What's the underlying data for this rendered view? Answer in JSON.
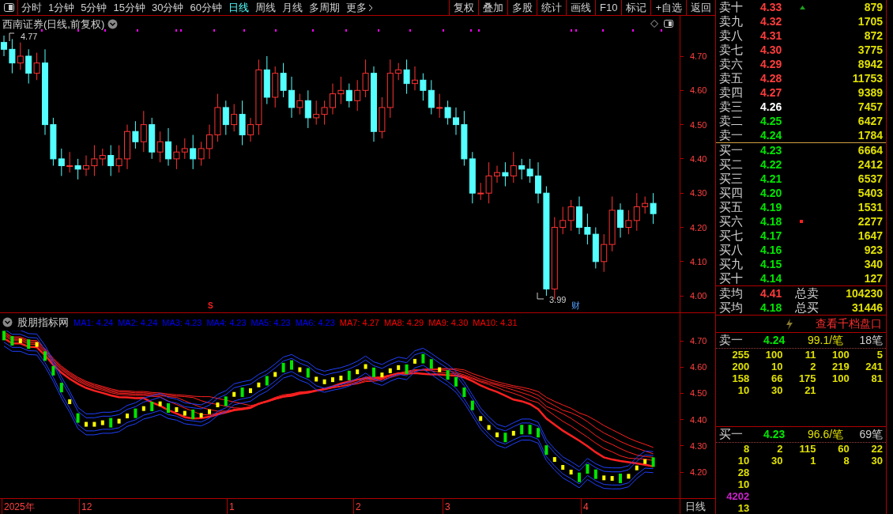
{
  "toolbar": {
    "periods": [
      {
        "label": "分时",
        "selected": false
      },
      {
        "label": "1分钟",
        "selected": false
      },
      {
        "label": "5分钟",
        "selected": false
      },
      {
        "label": "15分钟",
        "selected": false
      },
      {
        "label": "30分钟",
        "selected": false
      },
      {
        "label": "60分钟",
        "selected": false
      },
      {
        "label": "日线",
        "selected": true
      },
      {
        "label": "周线",
        "selected": false
      },
      {
        "label": "月线",
        "selected": false
      },
      {
        "label": "多周期",
        "selected": false
      },
      {
        "label": "更多",
        "selected": false
      }
    ],
    "buttons": [
      "复权",
      "叠加",
      "多股",
      "统计",
      "画线",
      "F10",
      "标记",
      "+自选",
      "返回"
    ]
  },
  "price_chart": {
    "title": "西南证券(日线,前复权)",
    "high_label": "4.77",
    "low_label": "3.99",
    "event_badge": "财",
    "sell_mark": "S",
    "yticks": [
      "4.70",
      "4.60",
      "4.50",
      "4.40",
      "4.30",
      "4.20",
      "4.10",
      "4.00"
    ]
  },
  "indicator": {
    "name": "股朋指标网",
    "ma": [
      {
        "label": "MA1: 4.24",
        "color": "#0000ff"
      },
      {
        "label": "MA2: 4.24",
        "color": "#0000ff"
      },
      {
        "label": "MA3: 4.23",
        "color": "#0000ff"
      },
      {
        "label": "MA4: 4.23",
        "color": "#0000ff"
      },
      {
        "label": "MA5: 4.23",
        "color": "#0000ff"
      },
      {
        "label": "MA6: 4.23",
        "color": "#0000ff"
      },
      {
        "label": "MA7: 4.27",
        "color": "#ff0000"
      },
      {
        "label": "MA8: 4.29",
        "color": "#ff0000"
      },
      {
        "label": "MA9: 4.30",
        "color": "#ff0000"
      },
      {
        "label": "MA10: 4.31",
        "color": "#ff0000"
      }
    ],
    "yticks": [
      "4.70",
      "4.60",
      "4.50",
      "4.40",
      "4.30",
      "4.20"
    ]
  },
  "time_axis": {
    "labels": [
      "2025年",
      "12",
      "1",
      "2",
      "3",
      "4"
    ],
    "period": "日线"
  },
  "order_book": {
    "asks": [
      {
        "label": "卖十",
        "price": "4.33",
        "volume": "879",
        "color": "#ff3c3c",
        "kind": "uptick"
      },
      {
        "label": "卖九",
        "price": "4.32",
        "volume": "1705",
        "color": "#ff3c3c",
        "kind": "plain"
      },
      {
        "label": "卖八",
        "price": "4.31",
        "volume": "872",
        "color": "#ff3c3c",
        "kind": "plain"
      },
      {
        "label": "卖七",
        "price": "4.30",
        "volume": "3775",
        "color": "#ff3c3c",
        "kind": "plain"
      },
      {
        "label": "卖六",
        "price": "4.29",
        "volume": "8942",
        "color": "#ff3c3c",
        "kind": "plain"
      },
      {
        "label": "卖五",
        "price": "4.28",
        "volume": "11753",
        "color": "#ff3c3c",
        "kind": "plain"
      },
      {
        "label": "卖四",
        "price": "4.27",
        "volume": "9389",
        "color": "#ff3c3c",
        "kind": "plain"
      },
      {
        "label": "卖三",
        "price": "4.26",
        "volume": "7457",
        "color": "#ffffff",
        "kind": "plain"
      },
      {
        "label": "卖二",
        "price": "4.25",
        "volume": "6427",
        "color": "#00e600",
        "kind": "plain"
      },
      {
        "label": "卖一",
        "price": "4.24",
        "volume": "1784",
        "color": "#00e600",
        "kind": "plain"
      }
    ],
    "bids": [
      {
        "label": "买一",
        "price": "4.23",
        "volume": "6664",
        "color": "#00e600",
        "kind": "plain"
      },
      {
        "label": "买二",
        "price": "4.22",
        "volume": "2412",
        "color": "#00e600",
        "kind": "plain"
      },
      {
        "label": "买三",
        "price": "4.21",
        "volume": "6537",
        "color": "#00e600",
        "kind": "plain"
      },
      {
        "label": "买四",
        "price": "4.20",
        "volume": "5403",
        "color": "#00e600",
        "kind": "plain"
      },
      {
        "label": "买五",
        "price": "4.19",
        "volume": "1531",
        "color": "#00e600",
        "kind": "plain"
      },
      {
        "label": "买六",
        "price": "4.18",
        "volume": "2277",
        "color": "#00e600",
        "kind": "flagged"
      },
      {
        "label": "买七",
        "price": "4.17",
        "volume": "1647",
        "color": "#00e600",
        "kind": "plain"
      },
      {
        "label": "买八",
        "price": "4.16",
        "volume": "923",
        "color": "#00e600",
        "kind": "plain"
      },
      {
        "label": "买九",
        "price": "4.15",
        "volume": "340",
        "color": "#00e600",
        "kind": "plain"
      },
      {
        "label": "买十",
        "price": "4.14",
        "volume": "127",
        "color": "#00e600",
        "kind": "plain"
      }
    ],
    "summary": [
      {
        "label": "卖均",
        "price": "4.41",
        "color": "#ff3c3c",
        "total_label": "总卖",
        "total": "104230"
      },
      {
        "label": "买均",
        "price": "4.18",
        "color": "#00e600",
        "total_label": "总买",
        "total": "31446"
      }
    ],
    "depth_link": "查看千档盘口",
    "queues": [
      {
        "label": "卖一",
        "price": "4.24",
        "average": "99.1/笔",
        "count": "18笔",
        "rows": [
          {
            "cells": [
              "255",
              "100",
              "11",
              "100",
              "5"
            ]
          },
          {
            "cells": [
              "200",
              "10",
              "2",
              "219",
              "241"
            ]
          },
          {
            "cells": [
              "158",
              "66",
              "175",
              "100",
              "81"
            ]
          },
          {
            "cells": [
              "10",
              "30",
              "21"
            ]
          }
        ]
      },
      {
        "label": "买一",
        "price": "4.23",
        "average": "96.6/笔",
        "count": "69笔",
        "rows": [
          {
            "cells": [
              "8",
              "2",
              "115",
              "60",
              "22"
            ]
          },
          {
            "cells": [
              "10",
              "30",
              "1",
              "8",
              "30"
            ]
          },
          {
            "cells": [
              "28"
            ]
          },
          {
            "cells": [
              "10"
            ]
          },
          {
            "cells": [
              "4202"
            ],
            "color": "#cc22cc"
          },
          {
            "cells": [
              "13"
            ]
          }
        ]
      }
    ]
  }
}
